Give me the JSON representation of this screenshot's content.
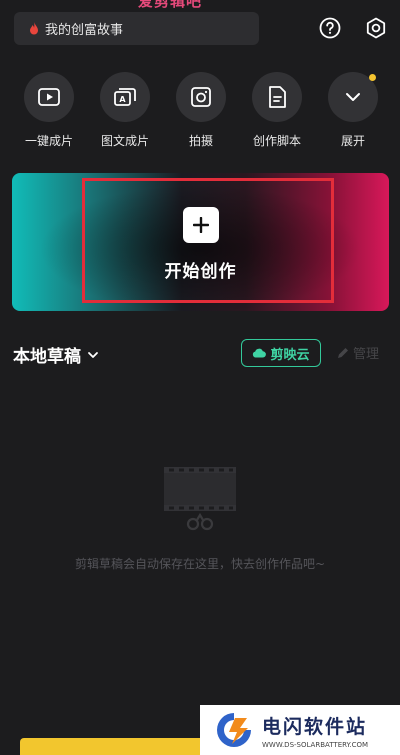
{
  "header": {
    "partial_title": "爱剪辑吧",
    "search_text": "我的创富故事"
  },
  "tools": [
    {
      "label": "一键成片",
      "icon": "play-video-icon"
    },
    {
      "label": "图文成片",
      "icon": "image-text-icon"
    },
    {
      "label": "拍摄",
      "icon": "camera-icon"
    },
    {
      "label": "创作脚本",
      "icon": "script-icon"
    },
    {
      "label": "展开",
      "icon": "chevron-down-icon"
    }
  ],
  "banner": {
    "label": "开始创作"
  },
  "drafts": {
    "title": "本地草稿",
    "cloud_label": "剪映云",
    "manage_label": "管理",
    "empty_text": "剪辑草稿会自动保存在这里，快去创作作品吧~"
  },
  "watermark": {
    "title": "电闪软件站",
    "url": "WWW.DS-SOLARBATTERY.COM"
  },
  "colors": {
    "background": "#1c1c1e",
    "accent_cloud": "#33c99a",
    "highlight_box": "#e32d3a",
    "notify_dot": "#f4c430"
  }
}
